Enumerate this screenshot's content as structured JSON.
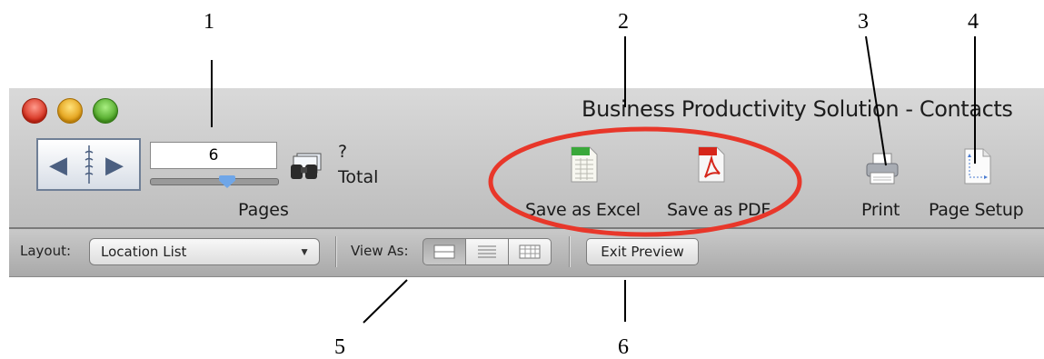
{
  "callouts": [
    "1",
    "2",
    "3",
    "4",
    "5",
    "6"
  ],
  "window": {
    "title": "Business Productivity Solution - Contacts"
  },
  "navigation": {
    "current_page": "6",
    "total_value": "?",
    "total_label": "Total",
    "pages_label": "Pages"
  },
  "toolbar": {
    "save_excel_label": "Save as Excel",
    "save_pdf_label": "Save as PDF",
    "print_label": "Print",
    "page_setup_label": "Page Setup"
  },
  "statusbar": {
    "layout_label": "Layout:",
    "layout_value": "Location List",
    "view_as_label": "View As:",
    "view_modes": [
      "form",
      "list",
      "table"
    ],
    "active_view_mode": "form",
    "exit_preview_label": "Exit Preview"
  },
  "colors": {
    "highlight_circle": "#e8372a",
    "traffic_red": "#d32a18",
    "traffic_yellow": "#e09a10",
    "traffic_green": "#4aa222"
  }
}
